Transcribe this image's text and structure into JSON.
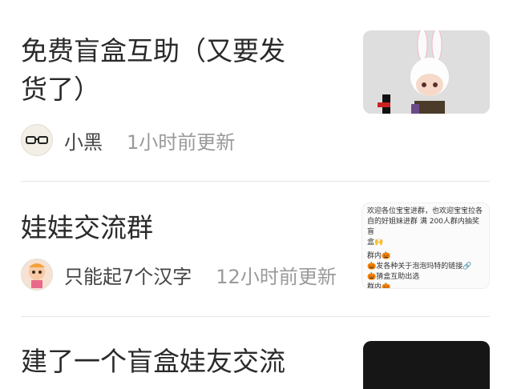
{
  "feed": {
    "items": [
      {
        "title_line1": "免费盲盒互助（又要发",
        "title_line2": "货了）",
        "author": "小黑",
        "time": "1小时前更新",
        "avatar_icon": "glasses-avatar-icon",
        "thumbnail": "bunny-doll-photo"
      },
      {
        "title_line1": "娃娃交流群",
        "author": "只能起7个汉字",
        "time": "12小时前更新",
        "avatar_icon": "doll-avatar-icon",
        "thumbnail": "group-notice-image",
        "notice": {
          "line1": "欢迎各位宝宝进群，也欢迎宝宝拉各",
          "line2": "自的好姐妹进群 满 200人群内抽奖盲",
          "line3": "盒🙌",
          "line4": "群内🎃",
          "line5": "🎃发各种关于泡泡玛特的链接🔗",
          "line6": "🎃猜盒互助出选",
          "line7": "群内🎃"
        }
      },
      {
        "title_line1": "建了一个盲盒娃友交流",
        "thumbnail": "dark-thumbnail"
      }
    ]
  },
  "colors": {
    "title": "#2a2a2a",
    "time": "#9a9a9a",
    "divider": "#e6e6e6"
  }
}
